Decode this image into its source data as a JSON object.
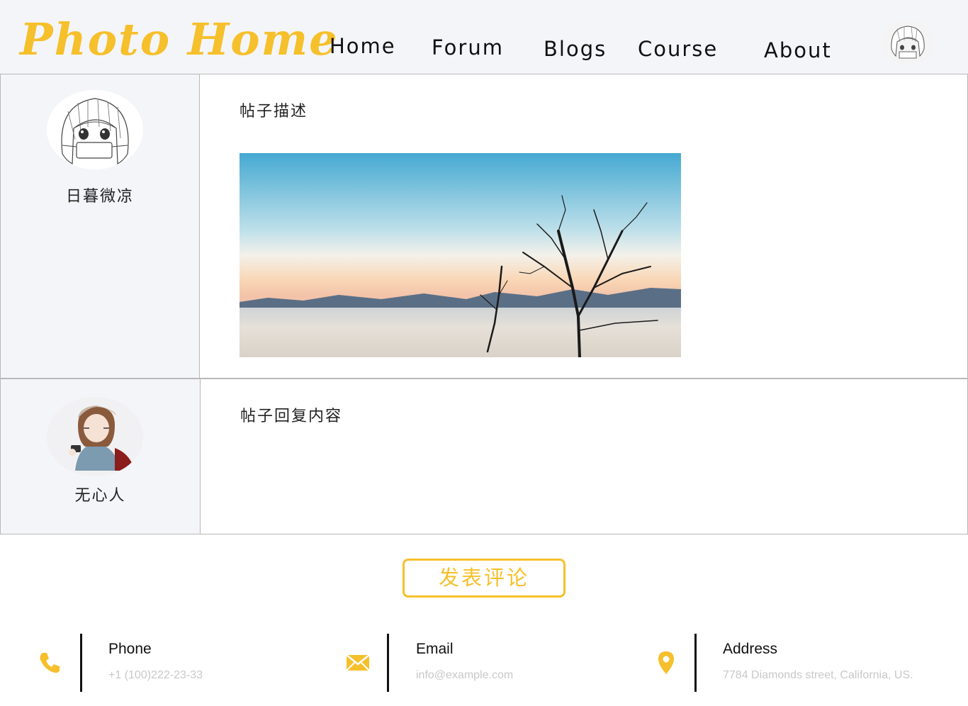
{
  "header": {
    "logo": "Photo Home",
    "nav": [
      "Home",
      "Forum",
      "Blogs",
      "Course",
      "About"
    ]
  },
  "posts": [
    {
      "author": "日暮微凉",
      "text": "帖子描述"
    },
    {
      "author": "无心人",
      "text": "帖子回复内容"
    }
  ],
  "comment_button": "发表评论",
  "contact": [
    {
      "icon": "phone-icon",
      "label": "Phone",
      "value": "+1 (100)222-23-33"
    },
    {
      "icon": "envelope-icon",
      "label": "Email",
      "value": "info@example.com"
    },
    {
      "icon": "location-pin-icon",
      "label": "Address",
      "value": "7784 Diamonds street, California, US."
    }
  ],
  "colors": {
    "accent": "#f6c02c",
    "header_bg": "#f4f5f9",
    "sidebar_bg": "#f4f5f9"
  }
}
